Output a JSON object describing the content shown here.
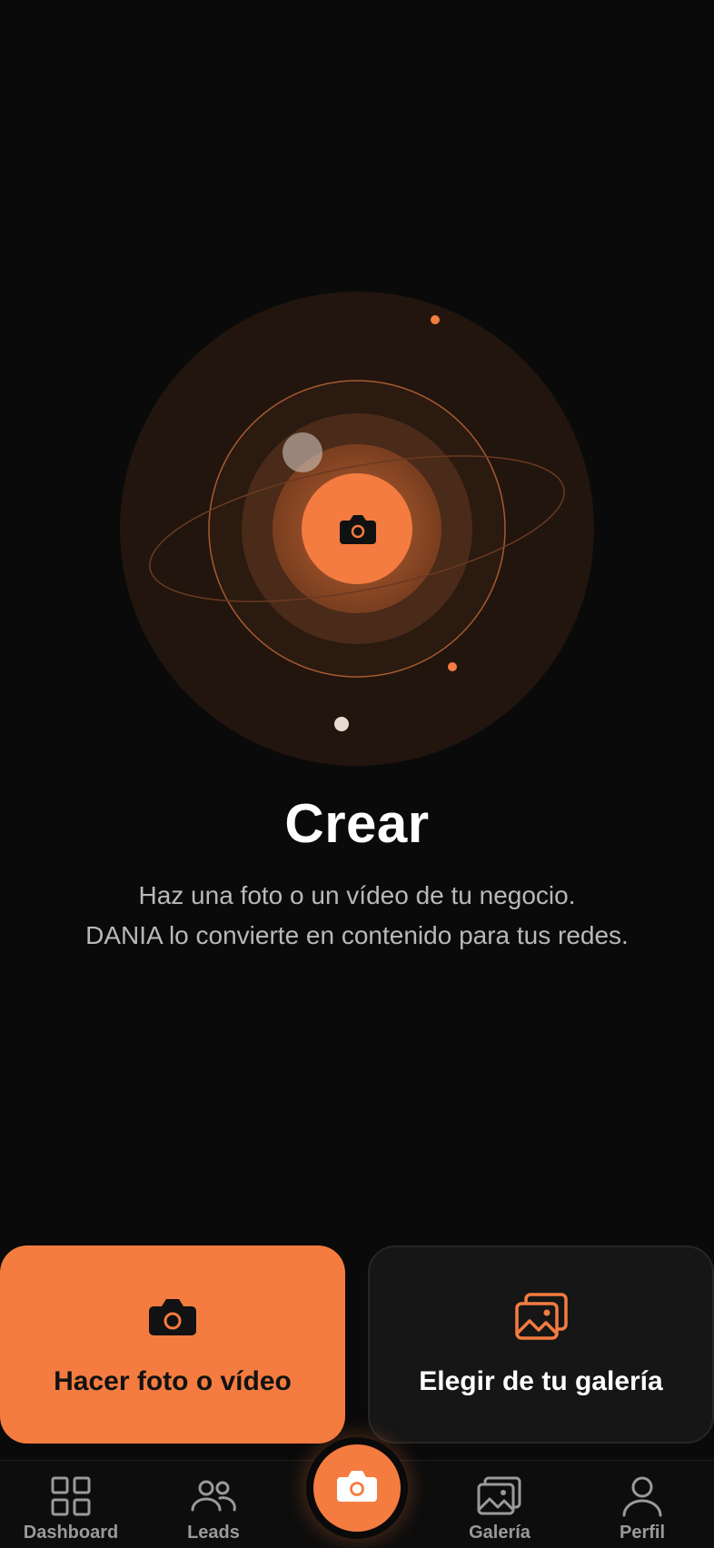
{
  "hero": {
    "icon": "camera-icon",
    "title": "Crear",
    "subtitle_lines": [
      "Haz una foto o un vídeo de tu negocio.",
      "DANIA lo convierte en contenido para tus redes."
    ]
  },
  "actions": {
    "take_photo": {
      "icon": "camera-icon",
      "label": "Hacer foto o vídeo"
    },
    "choose_gallery": {
      "icon": "gallery-icon",
      "label": "Elegir de tu galería"
    }
  },
  "tabbar": {
    "items": [
      {
        "icon": "dashboard-icon",
        "label": "Dashboard"
      },
      {
        "icon": "users-icon",
        "label": "Leads"
      },
      {
        "icon": "camera-icon",
        "label": ""
      },
      {
        "icon": "gallery-icon",
        "label": "Galería"
      },
      {
        "icon": "profile-icon",
        "label": "Perfil"
      }
    ]
  },
  "colors": {
    "accent": "#f47c40",
    "background": "#0a0a0a",
    "card_dark": "#161616",
    "muted_text": "#b9b9b9"
  }
}
